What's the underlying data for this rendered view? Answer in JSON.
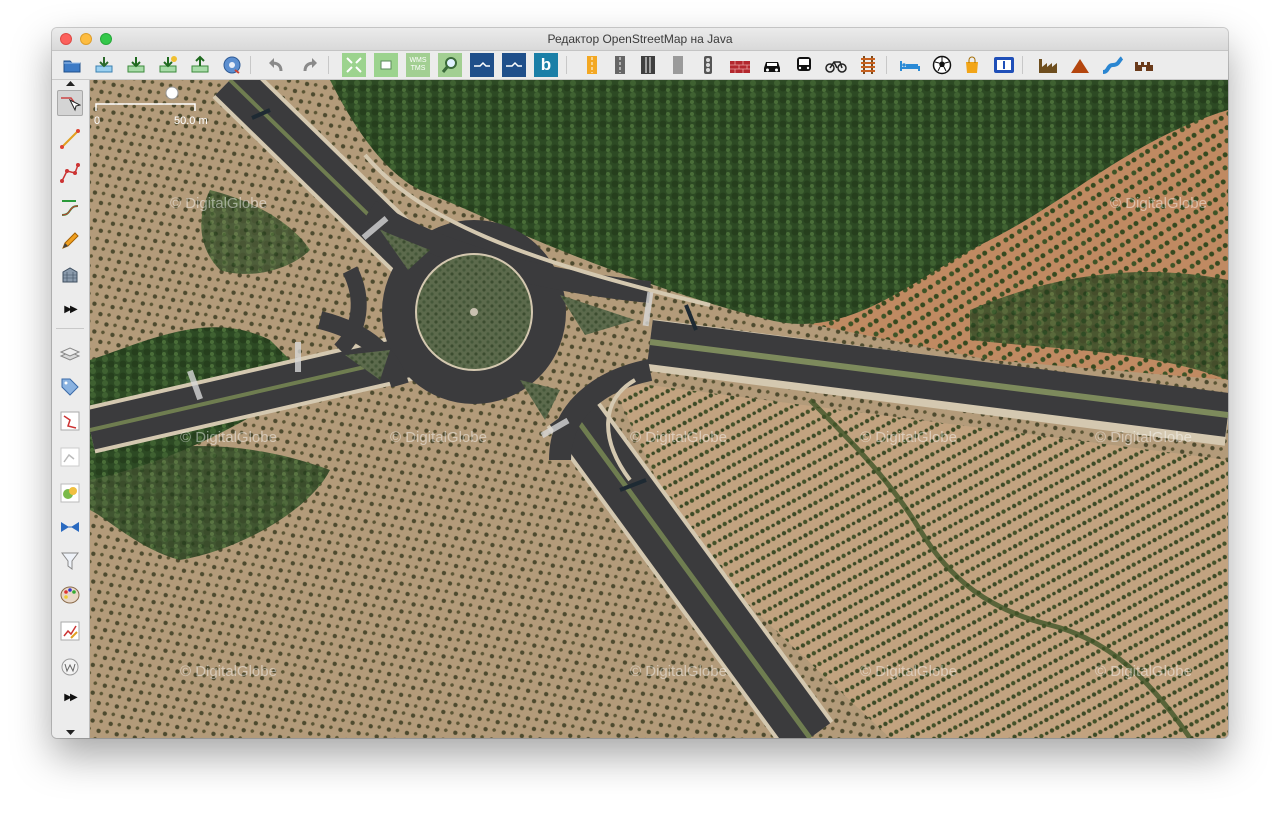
{
  "window": {
    "title": "Редактор OpenStreetMap на Java"
  },
  "toolbar": {
    "items": [
      {
        "icon": "open-file-icon"
      },
      {
        "icon": "download-icon"
      },
      {
        "icon": "download-along-icon"
      },
      {
        "icon": "download-new-layer-icon"
      },
      {
        "icon": "upload-icon"
      },
      {
        "icon": "preferences-icon"
      },
      {
        "icon": "undo-icon"
      },
      {
        "icon": "redo-icon"
      },
      {
        "icon": "zoom-to-data-icon"
      },
      {
        "icon": "zoom-to-selection-icon"
      },
      {
        "icon": "wms-layer-icon"
      },
      {
        "icon": "zoom-tool-icon"
      },
      {
        "icon": "imagery-layer-icon"
      },
      {
        "icon": "imagery-layer-icon"
      },
      {
        "icon": "bing-icon"
      },
      {
        "icon": "road-preset-icon"
      },
      {
        "icon": "road-preset-icon"
      },
      {
        "icon": "road-preset-icon"
      },
      {
        "icon": "road-preset-icon"
      },
      {
        "icon": "traffic-light-icon"
      },
      {
        "icon": "brick-wall-icon"
      },
      {
        "icon": "car-icon"
      },
      {
        "icon": "bus-icon"
      },
      {
        "icon": "bicycle-icon"
      },
      {
        "icon": "railway-icon"
      },
      {
        "icon": "hotel-bed-icon"
      },
      {
        "icon": "soccer-ball-icon"
      },
      {
        "icon": "shopping-bag-icon"
      },
      {
        "icon": "info-board-icon"
      },
      {
        "icon": "factory-icon"
      },
      {
        "icon": "peak-icon"
      },
      {
        "icon": "waterway-icon"
      },
      {
        "icon": "castle-icon"
      }
    ],
    "wms_label": "WMS\nTMS",
    "bing_glyph": "b"
  },
  "sidebar": {
    "items": [
      {
        "icon": "select-tool-icon"
      },
      {
        "icon": "draw-line-icon"
      },
      {
        "icon": "draw-node-icon"
      },
      {
        "icon": "improve-way-icon"
      },
      {
        "icon": "pencil-icon"
      },
      {
        "icon": "building-tool-icon"
      },
      {
        "icon": "more-tools-icon"
      },
      {
        "icon": "layers-icon"
      },
      {
        "icon": "tags-icon"
      },
      {
        "icon": "relations-icon"
      },
      {
        "icon": "selection-list-icon"
      },
      {
        "icon": "history-icon"
      },
      {
        "icon": "conflict-icon"
      },
      {
        "icon": "filter-icon"
      },
      {
        "icon": "map-paint-icon"
      },
      {
        "icon": "validation-icon"
      },
      {
        "icon": "wiki-icon"
      },
      {
        "icon": "more-toggles-icon"
      }
    ],
    "more_glyph": "▶▶"
  },
  "map": {
    "scale_start": "0",
    "scale_end": "50.0 m",
    "watermark": "© DigitalGlobe"
  },
  "colors": {
    "accent": "#1f4f8a",
    "bing": "#1a7fa7",
    "road": "#3b3b3d",
    "vegetation": "#2d4a24",
    "field": "#b59d7c"
  }
}
